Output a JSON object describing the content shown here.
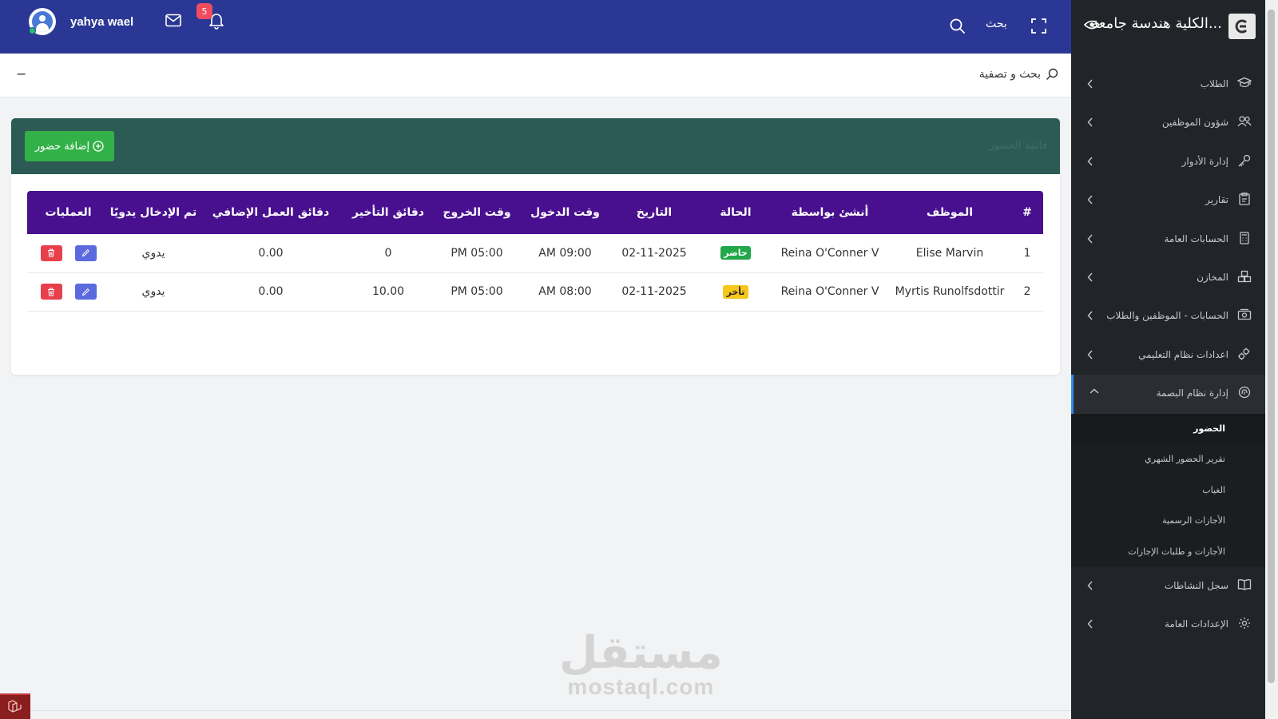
{
  "topbar": {
    "username": "yahya wael",
    "notification_count": "5",
    "search_label": "بحث",
    "icons": [
      "avatar",
      "mail-icon",
      "bell-icon",
      "search-icon",
      "fullscreen-icon"
    ]
  },
  "filter": {
    "title": "بحث و تصفية",
    "collapse_label": "−"
  },
  "card": {
    "title": "قائمة الحضور",
    "add_button": "إضافة حضور"
  },
  "table": {
    "headers": [
      "#",
      "الموظف",
      "أنشئ بواسطة",
      "الحالة",
      "التاريخ",
      "وقت الدخول",
      "وقت الخروج",
      "دقائق التأخير",
      "دقائق العمل الإضافي",
      "تم الإدخال يدويًا",
      "العمليات"
    ],
    "rows": [
      {
        "num": "1",
        "employee": "Elise Marvin",
        "created_by": "Reina O'Conner V",
        "status": "حاضر",
        "date": "02-11-2025",
        "time_in": "AM 09:00",
        "time_out": "PM 05:00",
        "late": "0",
        "overtime": "0.00",
        "manual": "يدوي"
      },
      {
        "num": "2",
        "employee": "Myrtis Runolfsdottir",
        "created_by": "Reina O'Conner V",
        "status": "تأخر",
        "date": "02-11-2025",
        "time_in": "AM 08:00",
        "time_out": "PM 05:00",
        "late": "10.00",
        "overtime": "0.00",
        "manual": "يدوي"
      }
    ]
  },
  "sidebar": {
    "brand": "الكلية هندسة جامعة...",
    "items": [
      {
        "label": "الطلاب"
      },
      {
        "label": "شؤون الموظفين"
      },
      {
        "label": "إدارة الأدوار"
      },
      {
        "label": "تقارير"
      },
      {
        "label": "الحسابات العامة"
      },
      {
        "label": "المخازن"
      },
      {
        "label": "الحسابات - الموظفين والطلاب"
      },
      {
        "label": "اعدادات نظام التعليمي"
      },
      {
        "label": "إدارة نظام البصمة"
      },
      {
        "label": "سجل النشاطات"
      },
      {
        "label": "الإعدادات العامة"
      }
    ],
    "subitems": [
      {
        "label": "الحضور"
      },
      {
        "label": "تقرير الحضور الشهري"
      },
      {
        "label": "الغياب"
      },
      {
        "label": "الأجازات الرسمية"
      },
      {
        "label": "الأجازات و طلبات الإجازات"
      }
    ]
  },
  "watermark": {
    "arabic": "مستقل",
    "latin": "mostaql.com"
  },
  "colors": {
    "topbar": "#2b3795",
    "sidebar": "#212529",
    "table_header": "#48108f",
    "card_header": "#2c5b55",
    "add_button": "#33b149",
    "present": "#22a74a",
    "late": "#f7c61b"
  }
}
